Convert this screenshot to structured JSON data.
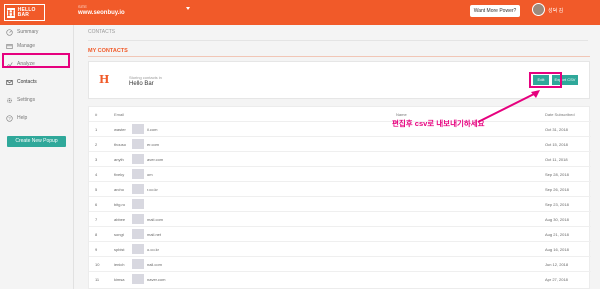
{
  "header": {
    "logo_text": "HELLO BAR",
    "site_label": "SITE",
    "site_url": "www.seonbuy.io",
    "want_more_label": "Want More Power?",
    "user_name": "성덕 김"
  },
  "sidebar": {
    "items": [
      {
        "label": "Summary",
        "icon": "summary-icon"
      },
      {
        "label": "Manage",
        "icon": "manage-icon"
      },
      {
        "label": "Analyze",
        "icon": "analyze-icon"
      },
      {
        "label": "Contacts",
        "icon": "contacts-icon"
      },
      {
        "label": "Settings",
        "icon": "settings-icon"
      },
      {
        "label": "Help",
        "icon": "help-icon"
      }
    ],
    "create_button": "Create New Popup"
  },
  "main": {
    "breadcrumb": "CONTACTS",
    "section_title": "MY CONTACTS",
    "card": {
      "subtitle": "Storing contacts in",
      "title": "Hello Bar",
      "edit_label": "Edit",
      "export_label": "Export CSV"
    },
    "annotation": "편집후 csv로 내보내기하세요",
    "table": {
      "headers": [
        "#",
        "Email",
        "Name",
        "Date Subscribed"
      ],
      "rows": [
        {
          "num": "1",
          "email_start": "waster",
          "email_end": "il.com",
          "name": "",
          "date": "Oct 31, 2018"
        },
        {
          "num": "2",
          "email_start": "thouso",
          "email_end": "er.com",
          "name": "",
          "date": "Oct 15, 2018"
        },
        {
          "num": "3",
          "email_start": "anyth",
          "email_end": "aver.com",
          "name": "",
          "date": "Oct 11, 2018"
        },
        {
          "num": "4",
          "email_start": "fiveky",
          "email_end": "om",
          "name": "",
          "date": "Sep 28, 2018"
        },
        {
          "num": "5",
          "email_start": "archo",
          "email_end": "r.co.kr",
          "name": "",
          "date": "Sep 26, 2018"
        },
        {
          "num": "6",
          "email_start": "bitg.ro",
          "email_end": "",
          "name": "",
          "date": "Sep 23, 2018"
        },
        {
          "num": "7",
          "email_start": "abbee",
          "email_end": "mail.com",
          "name": "",
          "date": "Aug 30, 2018"
        },
        {
          "num": "8",
          "email_start": "songt",
          "email_end": "mail.net",
          "name": "",
          "date": "Aug 21, 2018"
        },
        {
          "num": "9",
          "email_start": "spbist",
          "email_end": "o.co.kr",
          "name": "",
          "date": "Aug 16, 2018"
        },
        {
          "num": "10",
          "email_start": "ienich",
          "email_end": "nail.com",
          "name": "",
          "date": "Jun 12, 2018"
        },
        {
          "num": "11",
          "email_start": "kimsa",
          "email_end": "naver.com",
          "name": "",
          "date": "Apr 27, 2018"
        }
      ]
    }
  },
  "colors": {
    "brand": "#f15a29",
    "accent": "#2fa89a",
    "highlight": "#e6007e"
  }
}
